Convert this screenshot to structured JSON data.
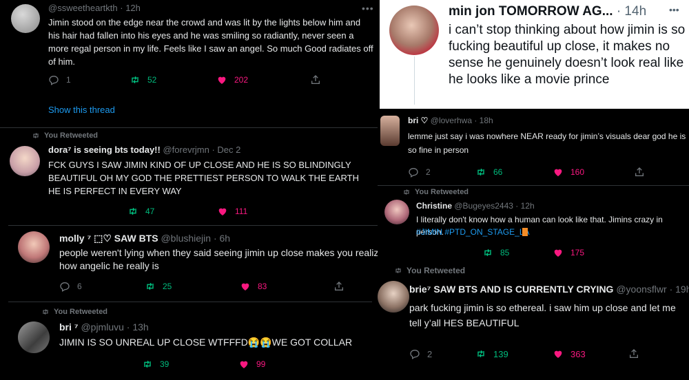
{
  "tweet1": {
    "handle": "@ssweetheartkth",
    "time": "· 12h",
    "text": "Jimin stood on the edge near the crowd and was lit by the lights below him and his hair had fallen into his eyes and he was smiling so radiantly, never seen a more regal person in my life. Feels like I saw an angel. So much Good radiates off of him.",
    "replies": "1",
    "retweets": "52",
    "likes": "202",
    "show_thread": "Show this thread"
  },
  "tweet2": {
    "retweet_label": "You Retweeted",
    "name": "dora⁷ is seeing bts today!!",
    "handle": "@forevrjmn · Dec 2",
    "text": "FCK GUYS I SAW JIMIN KIND OF UP CLOSE AND HE IS SO BLINDINGLY BEAUTIFUL OH MY GOD THE PRETTIEST PERSON TO WALK THE EARTH HE IS PERFECT IN EVERY WAY",
    "retweets": "47",
    "likes": "111"
  },
  "tweet3": {
    "retweet_label": "You Retweeted",
    "name": "molly ⁷ ⬚♡ SAW BTS",
    "handle": "@blushiejin · 6h",
    "text": "people weren't lying when they said seeing jimin up close makes you realize how angelic he really is",
    "replies": "6",
    "retweets": "25",
    "likes": "83"
  },
  "tweet4": {
    "retweet_label": "You Retweeted",
    "name": "bri ⁷",
    "handle": "@pjmluvu · 13h",
    "text": "JIMIN IS SO UNREAL UP CLOSE WTFFFD😭😭WE GOT COLLAR",
    "retweets": "39",
    "likes": "99"
  },
  "tweet5": {
    "name": "min jon TOMORROW AG...",
    "time": "· 14h",
    "text": "i can’t stop thinking about how jimin is so fucking beautiful up close, it makes no sense he genuinely doesn’t look real like he looks like a movie prince"
  },
  "tweet6": {
    "name": "bri ♡",
    "handle": "@loverhwa · 18h",
    "text": "lemme just say i was nowhere NEAR ready for jimin’s visuals dear god he is so fine in person",
    "replies": "2",
    "retweets": "66",
    "likes": "160"
  },
  "tweet7": {
    "retweet_label": "You Retweeted",
    "name": "Christine",
    "handle": "@Bugeyes2443 · 12h",
    "text": "I literally don't know how a human can look like that. Jimins crazy in person.",
    "hashtags": "#JIMIN #PTD_ON_STAGE_LA",
    "retweets": "85",
    "likes": "175"
  },
  "tweet8": {
    "retweet_label": "You Retweeted",
    "name": "brie⁷ SAW BTS AND IS CURRENTLY CRYING",
    "handle": "@yoonsflwr · 19h",
    "text": "park fucking jimin is so ethereal. i saw him up close and let me tell y’all HES BEAUTIFUL",
    "replies": "2",
    "retweets": "139",
    "likes": "363"
  },
  "colors": {
    "like": "#f91880",
    "retweet": "#00ba7c",
    "link": "#1d9bf0",
    "muted": "#71767b"
  }
}
